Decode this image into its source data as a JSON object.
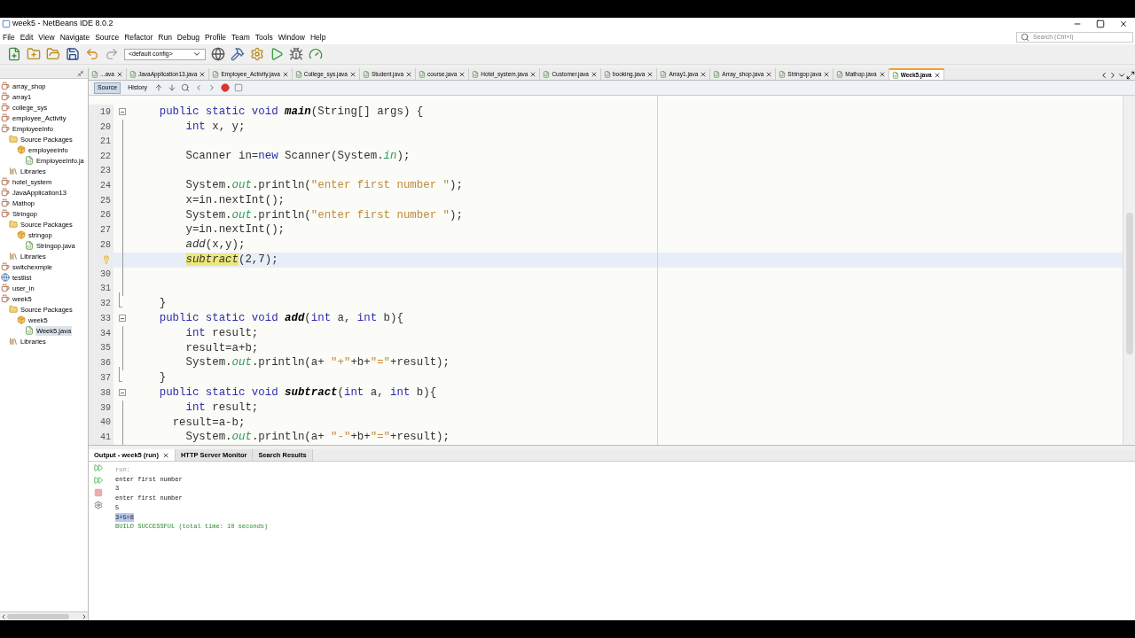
{
  "window": {
    "title": "week5 - NetBeans IDE 8.0.2"
  },
  "menu": [
    "File",
    "Edit",
    "View",
    "Navigate",
    "Source",
    "Refactor",
    "Run",
    "Debug",
    "Profile",
    "Team",
    "Tools",
    "Window",
    "Help"
  ],
  "config_select": {
    "value": "<default config>"
  },
  "search": {
    "placeholder": "Search (Ctrl+I)"
  },
  "project_tree": [
    {
      "label": "array_shop",
      "kind": "project",
      "selected": false
    },
    {
      "label": "array1",
      "kind": "project",
      "selected": false
    },
    {
      "label": "college_sys",
      "kind": "project",
      "selected": false
    },
    {
      "label": "employee_Activity",
      "kind": "project",
      "selected": false
    },
    {
      "label": "EmployeeInfo",
      "kind": "project",
      "selected": false,
      "children": [
        {
          "label": "Source Packages",
          "kind": "folder",
          "selected": false,
          "children": [
            {
              "label": "employeeinfo",
              "kind": "package",
              "selected": false,
              "children": [
                {
                  "label": "EmployeeInfo.ja",
                  "kind": "file",
                  "selected": false
                }
              ]
            }
          ]
        },
        {
          "label": "Libraries",
          "kind": "library",
          "selected": false
        }
      ]
    },
    {
      "label": "hotel_system",
      "kind": "project",
      "selected": false
    },
    {
      "label": "JavaApplication13",
      "kind": "project",
      "selected": false
    },
    {
      "label": "Mathop",
      "kind": "project",
      "selected": false
    },
    {
      "label": "Stringop",
      "kind": "project",
      "selected": false,
      "children": [
        {
          "label": "Source Packages",
          "kind": "folder",
          "selected": false,
          "children": [
            {
              "label": "stringop",
              "kind": "package",
              "selected": false,
              "children": [
                {
                  "label": "Stringop.java",
                  "kind": "file",
                  "selected": false
                }
              ]
            }
          ]
        },
        {
          "label": "Libraries",
          "kind": "library",
          "selected": false
        }
      ]
    },
    {
      "label": "switchexmple",
      "kind": "project",
      "selected": false
    },
    {
      "label": "testlist",
      "kind": "globe",
      "selected": false
    },
    {
      "label": "user_in",
      "kind": "project",
      "selected": false
    },
    {
      "label": "week5",
      "kind": "project",
      "selected": false,
      "children": [
        {
          "label": "Source Packages",
          "kind": "folder",
          "selected": false,
          "children": [
            {
              "label": "week5",
              "kind": "package",
              "selected": false,
              "children": [
                {
                  "label": "Week5.java",
                  "kind": "file",
                  "selected": true
                }
              ]
            }
          ]
        },
        {
          "label": "Libraries",
          "kind": "library",
          "selected": false
        }
      ]
    }
  ],
  "editor_tabs": [
    {
      "label": "...ava",
      "selected": false
    },
    {
      "label": "JavaApplication13.java",
      "selected": false
    },
    {
      "label": "Employee_Activity.java",
      "selected": false
    },
    {
      "label": "College_sys.java",
      "selected": false
    },
    {
      "label": "Student.java",
      "selected": false
    },
    {
      "label": "course.java",
      "selected": false
    },
    {
      "label": "Hotel_system.java",
      "selected": false
    },
    {
      "label": "Customer.java",
      "selected": false
    },
    {
      "label": "booking.java",
      "selected": false
    },
    {
      "label": "Array1.java",
      "selected": false
    },
    {
      "label": "Array_shop.java",
      "selected": false
    },
    {
      "label": "Stringop.java",
      "selected": false
    },
    {
      "label": "Mathop.java",
      "selected": false
    },
    {
      "label": "Week5.java",
      "selected": true
    }
  ],
  "view_tabs": [
    {
      "label": "Source",
      "selected": true
    },
    {
      "label": "History",
      "selected": false
    }
  ],
  "code": [
    {
      "n": "19",
      "fold_toggle": true,
      "fold_end": false,
      "current": false,
      "hint": false,
      "tokens": [
        {
          "t": "    public static void ",
          "kind": "kw"
        },
        {
          "t": "main",
          "kind": "bold"
        },
        {
          "t": "(String[] args) {",
          "kind": "plain"
        }
      ]
    },
    {
      "n": "20",
      "fold_toggle": false,
      "fold_end": false,
      "current": false,
      "hint": false,
      "tokens": [
        {
          "t": "        int",
          "kind": "kw"
        },
        {
          "t": " x, y;",
          "kind": "plain"
        }
      ]
    },
    {
      "n": "21",
      "fold_toggle": false,
      "fold_end": false,
      "current": false,
      "hint": false
    },
    {
      "n": "22",
      "fold_toggle": false,
      "fold_end": false,
      "current": false,
      "hint": false,
      "tokens": [
        {
          "t": "        Scanner in=",
          "kind": "plain"
        },
        {
          "t": "new",
          "kind": "kw"
        },
        {
          "t": " Scanner(System.",
          "kind": "plain"
        },
        {
          "t": "in",
          "kind": "field"
        },
        {
          "t": ");",
          "kind": "plain"
        }
      ]
    },
    {
      "n": "23",
      "fold_toggle": false,
      "fold_end": false,
      "current": false,
      "hint": false
    },
    {
      "n": "24",
      "fold_toggle": false,
      "fold_end": false,
      "current": false,
      "hint": false,
      "tokens": [
        {
          "t": "        System.",
          "kind": "plain"
        },
        {
          "t": "out",
          "kind": "field"
        },
        {
          "t": ".println(",
          "kind": "plain"
        },
        {
          "t": "\"enter first number \"",
          "kind": "str"
        },
        {
          "t": ");",
          "kind": "plain"
        }
      ]
    },
    {
      "n": "25",
      "fold_toggle": false,
      "fold_end": false,
      "current": false,
      "hint": false,
      "tokens": [
        {
          "t": "        x=in.nextInt();",
          "kind": "plain"
        }
      ]
    },
    {
      "n": "26",
      "fold_toggle": false,
      "fold_end": false,
      "current": false,
      "hint": false,
      "tokens": [
        {
          "t": "        System.",
          "kind": "plain"
        },
        {
          "t": "out",
          "kind": "field"
        },
        {
          "t": ".println(",
          "kind": "plain"
        },
        {
          "t": "\"enter first number \"",
          "kind": "str"
        },
        {
          "t": ");",
          "kind": "plain"
        }
      ]
    },
    {
      "n": "27",
      "fold_toggle": false,
      "fold_end": false,
      "current": false,
      "hint": false,
      "tokens": [
        {
          "t": "        y=in.nextInt();",
          "kind": "plain"
        }
      ]
    },
    {
      "n": "28",
      "fold_toggle": false,
      "fold_end": false,
      "current": false,
      "hint": false,
      "tokens": [
        {
          "t": "        add",
          "kind": "call"
        },
        {
          "t": "(x,y);",
          "kind": "plain"
        }
      ]
    },
    {
      "fold_toggle": false,
      "fold_end": false,
      "current": true,
      "hint": true,
      "tokens": [
        {
          "t": "        subtract",
          "kind": "mark"
        },
        {
          "t": "(2,7);",
          "kind": "plain"
        }
      ]
    },
    {
      "n": "30",
      "fold_toggle": false,
      "fold_end": false,
      "current": false,
      "hint": false
    },
    {
      "n": "31",
      "fold_toggle": false,
      "fold_end": false,
      "current": false,
      "hint": false
    },
    {
      "n": "32",
      "fold_toggle": false,
      "fold_end": true,
      "current": false,
      "hint": false,
      "tokens": [
        {
          "t": "    }",
          "kind": "plain"
        }
      ]
    },
    {
      "n": "33",
      "fold_toggle": true,
      "fold_end": false,
      "current": false,
      "hint": false,
      "tokens": [
        {
          "t": "    public static void ",
          "kind": "kw"
        },
        {
          "t": "add",
          "kind": "bold"
        },
        {
          "t": "(",
          "kind": "plain"
        },
        {
          "t": "int",
          "kind": "kw"
        },
        {
          "t": " a, ",
          "kind": "plain"
        },
        {
          "t": "int",
          "kind": "kw"
        },
        {
          "t": " b){",
          "kind": "plain"
        }
      ]
    },
    {
      "n": "34",
      "fold_toggle": false,
      "fold_end": false,
      "current": false,
      "hint": false,
      "tokens": [
        {
          "t": "        int",
          "kind": "kw"
        },
        {
          "t": " result;",
          "kind": "plain"
        }
      ]
    },
    {
      "n": "35",
      "fold_toggle": false,
      "fold_end": false,
      "current": false,
      "hint": false,
      "tokens": [
        {
          "t": "        result=a+b;",
          "kind": "plain"
        }
      ]
    },
    {
      "n": "36",
      "fold_toggle": false,
      "fold_end": false,
      "current": false,
      "hint": false,
      "tokens": [
        {
          "t": "        System.",
          "kind": "plain"
        },
        {
          "t": "out",
          "kind": "field"
        },
        {
          "t": ".println(a+ ",
          "kind": "plain"
        },
        {
          "t": "\"+\"",
          "kind": "str"
        },
        {
          "t": "+b+",
          "kind": "plain"
        },
        {
          "t": "\"=\"",
          "kind": "str"
        },
        {
          "t": "+result);",
          "kind": "plain"
        }
      ]
    },
    {
      "n": "37",
      "fold_toggle": false,
      "fold_end": true,
      "current": false,
      "hint": false,
      "tokens": [
        {
          "t": "    }",
          "kind": "plain"
        }
      ]
    },
    {
      "n": "38",
      "fold_toggle": true,
      "fold_end": false,
      "current": false,
      "hint": false,
      "tokens": [
        {
          "t": "    public static void ",
          "kind": "kw"
        },
        {
          "t": "subtract",
          "kind": "bold"
        },
        {
          "t": "(",
          "kind": "plain"
        },
        {
          "t": "int",
          "kind": "kw"
        },
        {
          "t": " a, ",
          "kind": "plain"
        },
        {
          "t": "int",
          "kind": "kw"
        },
        {
          "t": " b){",
          "kind": "plain"
        }
      ]
    },
    {
      "n": "39",
      "fold_toggle": false,
      "fold_end": false,
      "current": false,
      "hint": false,
      "tokens": [
        {
          "t": "        int",
          "kind": "kw"
        },
        {
          "t": " result;",
          "kind": "plain"
        }
      ]
    },
    {
      "n": "40",
      "fold_toggle": false,
      "fold_end": false,
      "current": false,
      "hint": false,
      "tokens": [
        {
          "t": "      result=a-b;",
          "kind": "plain"
        }
      ]
    },
    {
      "n": "41",
      "fold_toggle": false,
      "fold_end": false,
      "current": false,
      "hint": false,
      "tokens": [
        {
          "t": "        System.",
          "kind": "plain"
        },
        {
          "t": "out",
          "kind": "field"
        },
        {
          "t": ".println(a+ ",
          "kind": "plain"
        },
        {
          "t": "\"-\"",
          "kind": "str"
        },
        {
          "t": "+b+",
          "kind": "plain"
        },
        {
          "t": "\"=\"",
          "kind": "str"
        },
        {
          "t": "+result);",
          "kind": "plain"
        }
      ]
    }
  ],
  "output_tabs": [
    {
      "label": "Output - week5 (run)",
      "selected": true,
      "closable": true
    },
    {
      "label": "HTTP Server Monitor",
      "selected": false,
      "closable": false
    },
    {
      "label": "Search Results",
      "selected": false,
      "closable": false
    }
  ],
  "output": [
    {
      "text": "run:",
      "kind": "muted",
      "selected": false
    },
    {
      "text": "enter first number",
      "kind": "normal",
      "selected": false
    },
    {
      "text": "3",
      "kind": "normal",
      "selected": false
    },
    {
      "text": "enter first number",
      "kind": "normal",
      "selected": false
    },
    {
      "text": "5",
      "kind": "normal",
      "selected": false
    },
    {
      "text": "3+5=8",
      "kind": "normal",
      "selected": true
    },
    {
      "text": "BUILD SUCCESSFUL (total time: 10 seconds)",
      "kind": "success",
      "selected": false
    }
  ]
}
